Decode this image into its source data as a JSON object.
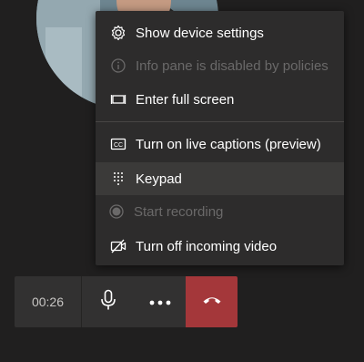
{
  "participant": {
    "avatar_icon": "participant-photo"
  },
  "menu": {
    "items": [
      {
        "label": "Show device settings",
        "icon": "gear-icon",
        "enabled": true
      },
      {
        "label": "Info pane is disabled by policies",
        "icon": "info-icon",
        "enabled": false
      },
      {
        "label": "Enter full screen",
        "icon": "fullscreen-icon",
        "enabled": true
      },
      {
        "label": "Turn on live captions (preview)",
        "icon": "captions-icon",
        "enabled": true
      },
      {
        "label": "Keypad",
        "icon": "keypad-icon",
        "enabled": true,
        "highlighted": true
      },
      {
        "label": "Start recording",
        "icon": "record-icon",
        "enabled": false
      },
      {
        "label": "Turn off incoming video",
        "icon": "video-off-icon",
        "enabled": true
      }
    ]
  },
  "callbar": {
    "timer": "00:26",
    "buttons": [
      {
        "name": "mute",
        "icon": "microphone-icon"
      },
      {
        "name": "more-actions",
        "icon": "more-icon"
      },
      {
        "name": "hang-up",
        "icon": "hang-up-icon",
        "color": "#a4373a"
      }
    ]
  },
  "colors": {
    "background": "#201f1f",
    "menu_bg": "#2d2c2c",
    "menu_hover": "#3b3a39",
    "disabled_text": "#6a6969",
    "hangup": "#a4373a"
  }
}
